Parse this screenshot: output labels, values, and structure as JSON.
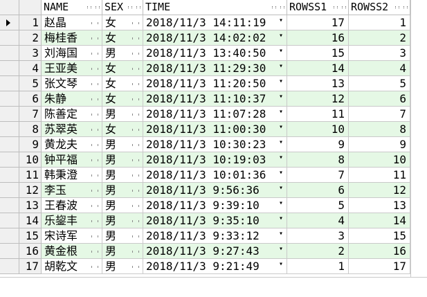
{
  "columns": {
    "name": "NAME",
    "sex": "SEX",
    "time": "TIME",
    "rowss1": "ROWSS1",
    "rowss2": "ROWSS2"
  },
  "rows": [
    {
      "n": "1",
      "name": "赵晶",
      "sex": "女",
      "time": "2018/11/3 14:11:19",
      "r1": "17",
      "r2": "1"
    },
    {
      "n": "2",
      "name": "梅桂香",
      "sex": "女",
      "time": "2018/11/3 14:02:02",
      "r1": "16",
      "r2": "2"
    },
    {
      "n": "3",
      "name": "刘海国",
      "sex": "男",
      "time": "2018/11/3 13:40:50",
      "r1": "15",
      "r2": "3"
    },
    {
      "n": "4",
      "name": "王亚美",
      "sex": "女",
      "time": "2018/11/3 11:29:30",
      "r1": "14",
      "r2": "4"
    },
    {
      "n": "5",
      "name": "张文琴",
      "sex": "女",
      "time": "2018/11/3 11:20:50",
      "r1": "13",
      "r2": "5"
    },
    {
      "n": "6",
      "name": "朱静",
      "sex": "女",
      "time": "2018/11/3 11:10:37",
      "r1": "12",
      "r2": "6"
    },
    {
      "n": "7",
      "name": "陈善定",
      "sex": "男",
      "time": "2018/11/3 11:07:28",
      "r1": "11",
      "r2": "7"
    },
    {
      "n": "8",
      "name": "苏翠英",
      "sex": "女",
      "time": "2018/11/3 11:00:30",
      "r1": "10",
      "r2": "8"
    },
    {
      "n": "9",
      "name": "黄龙夫",
      "sex": "男",
      "time": "2018/11/3 10:30:23",
      "r1": "9",
      "r2": "9"
    },
    {
      "n": "10",
      "name": "钟平福",
      "sex": "男",
      "time": "2018/11/3 10:19:03",
      "r1": "8",
      "r2": "10"
    },
    {
      "n": "11",
      "name": "韩秉澄",
      "sex": "男",
      "time": "2018/11/3 10:01:36",
      "r1": "7",
      "r2": "11"
    },
    {
      "n": "12",
      "name": "李玉",
      "sex": "男",
      "time": "2018/11/3 9:56:36",
      "r1": "6",
      "r2": "12"
    },
    {
      "n": "13",
      "name": "王春波",
      "sex": "男",
      "time": "2018/11/3 9:39:10",
      "r1": "5",
      "r2": "13"
    },
    {
      "n": "14",
      "name": "乐鋆丰",
      "sex": "男",
      "time": "2018/11/3 9:35:10",
      "r1": "4",
      "r2": "14"
    },
    {
      "n": "15",
      "name": "宋诗军",
      "sex": "男",
      "time": "2018/11/3 9:33:12",
      "r1": "3",
      "r2": "15"
    },
    {
      "n": "16",
      "name": "黄金根",
      "sex": "男",
      "time": "2018/11/3 9:27:43",
      "r1": "2",
      "r2": "16"
    },
    {
      "n": "17",
      "name": "胡乾文",
      "sex": "男",
      "time": "2018/11/3 9:21:49",
      "r1": "1",
      "r2": "17"
    }
  ],
  "icons": {
    "current_row": "current-row-arrow-icon",
    "dropdown": "dropdown-arrow-icon",
    "ellipsis": "ellipsis-button-icon"
  },
  "colors": {
    "alt_row": "#e5f8e5",
    "grid_line": "#c9c9c9"
  }
}
